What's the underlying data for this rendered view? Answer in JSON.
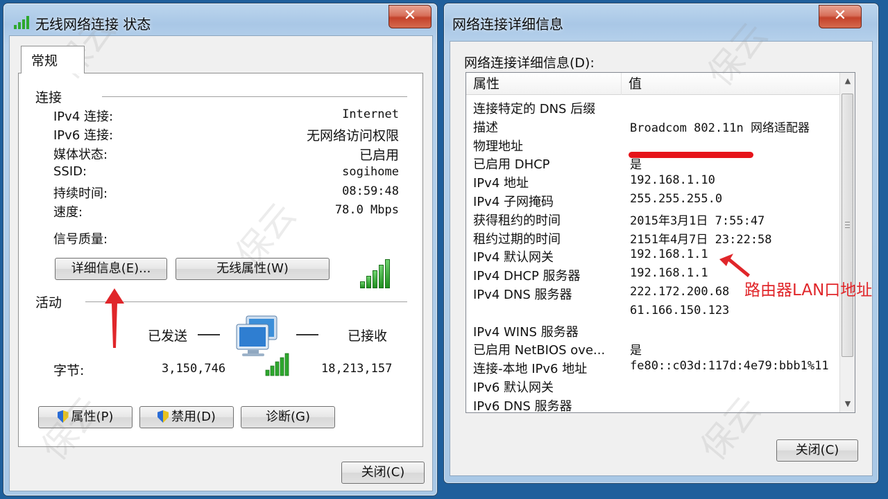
{
  "left_window": {
    "title": "无线网络连接 状态",
    "close_glyph": "✕",
    "tab_general": "常规",
    "connection_section": "连接",
    "rows": [
      {
        "label": "IPv4 连接:",
        "value": "Internet"
      },
      {
        "label": "IPv6 连接:",
        "value": "无网络访问权限"
      },
      {
        "label": "媒体状态:",
        "value": "已启用"
      },
      {
        "label": "SSID:",
        "value": "sogihome"
      },
      {
        "label": "持续时间:",
        "value": "08:59:48"
      },
      {
        "label": "速度:",
        "value": "78.0 Mbps"
      }
    ],
    "signal_label": "信号质量:",
    "details_button": "详细信息(E)...",
    "wireless_props_button": "无线属性(W)",
    "activity_section": "活动",
    "sent_label": "已发送",
    "received_label": "已接收",
    "bytes_label": "字节:",
    "bytes_sent": "3,150,746",
    "bytes_received": "18,213,157",
    "properties_button": "属性(P)",
    "disable_button": "禁用(D)",
    "diagnose_button": "诊断(G)",
    "close_button": "关闭(C)"
  },
  "right_window": {
    "title": "网络连接详细信息",
    "close_glyph": "✕",
    "caption": "网络连接详细信息(D):",
    "col_property": "属性",
    "col_value": "值",
    "rows": [
      {
        "prop": "连接特定的 DNS 后缀",
        "val": ""
      },
      {
        "prop": "描述",
        "val": "Broadcom 802.11n 网络适配器"
      },
      {
        "prop": "物理地址",
        "val": ""
      },
      {
        "prop": "已启用 DHCP",
        "val": "是"
      },
      {
        "prop": "IPv4 地址",
        "val": "192.168.1.10"
      },
      {
        "prop": "IPv4 子网掩码",
        "val": "255.255.255.0"
      },
      {
        "prop": "获得租约的时间",
        "val": "2015年3月1日 7:55:47"
      },
      {
        "prop": "租约过期的时间",
        "val": "2151年4月7日 23:22:58"
      },
      {
        "prop": "IPv4 默认网关",
        "val": "192.168.1.1"
      },
      {
        "prop": "IPv4 DHCP 服务器",
        "val": "192.168.1.1"
      },
      {
        "prop": "IPv4 DNS 服务器",
        "val": "222.172.200.68"
      },
      {
        "prop": "",
        "val": "61.166.150.123"
      },
      {
        "prop": "IPv4 WINS 服务器",
        "val": ""
      },
      {
        "prop": "已启用 NetBIOS ove...",
        "val": "是"
      },
      {
        "prop": "连接-本地 IPv6 地址",
        "val": "fe80::c03d:117d:4e79:bbb1%11"
      },
      {
        "prop": "IPv6 默认网关",
        "val": ""
      },
      {
        "prop": "IPv6 DNS 服务器",
        "val": ""
      }
    ],
    "annotation": "路由器LAN口地址",
    "close_button": "关闭(C)"
  },
  "watermark_text": "保云",
  "colors": {
    "accent_red": "#e0262a",
    "signal_green": "#2ea82e",
    "desktop_blue": "#1f5f9c"
  }
}
